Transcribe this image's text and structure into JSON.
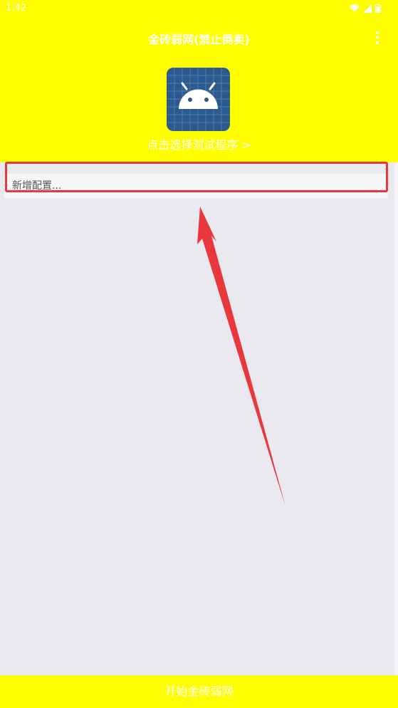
{
  "status_bar": {
    "time": "1:42"
  },
  "toolbar": {
    "title": "金砖弱网(禁止倒卖)",
    "menu_icon": "more-vert-icon"
  },
  "app_selector": {
    "icon": "android-app-icon",
    "label": "点击选择测试程序 >"
  },
  "config_list": {
    "add_item_label": "新增配置..."
  },
  "bottom_bar": {
    "start_label": "开始金砖弱网"
  },
  "colors": {
    "accent_yellow": "#ffff00",
    "text_white": "#ffffff",
    "background": "#e9e9ef",
    "annotation_red": "#e8383c",
    "icon_blue": "#2b5a8e"
  }
}
